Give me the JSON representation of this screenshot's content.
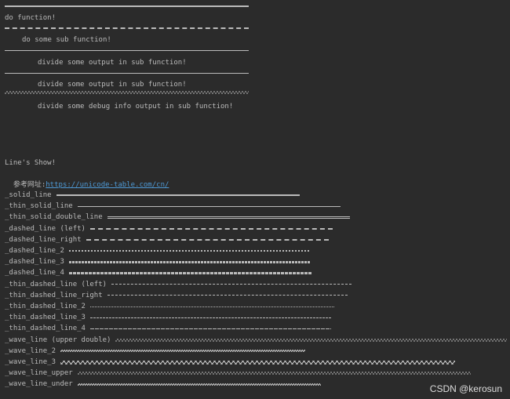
{
  "top": {
    "do_function": "do function!",
    "sub_function": "do some sub function!",
    "divide_output_1": "divide some output in sub function!",
    "divide_output_2": "divide some output in sub function!",
    "divide_debug": "divide some debug info output in sub function!"
  },
  "show": {
    "title": "Line's Show!",
    "ref_label": "参考网址:",
    "ref_url": "https://unicode-table.com/cn/"
  },
  "lines": [
    {
      "label": "_solid_line",
      "style": "solid"
    },
    {
      "label": "_thin_solid_line",
      "style": "thin"
    },
    {
      "label": "_thin_solid_double_line",
      "style": "double"
    },
    {
      "label": "_dashed_line (left)",
      "style": "dashed"
    },
    {
      "label": "_dashed_line_right",
      "style": "dashed"
    },
    {
      "label": "_dashed_line_2",
      "style": "dashed2"
    },
    {
      "label": "_dashed_line_3",
      "style": "dashed3"
    },
    {
      "label": "_dashed_line_4",
      "style": "dashed4"
    },
    {
      "label": "_thin_dashed_line (left)",
      "style": "tdashed"
    },
    {
      "label": "_thin_dashed_line_right",
      "style": "tdashed"
    },
    {
      "label": "_thin_dashed_line_2",
      "style": "tdashed2"
    },
    {
      "label": "_thin_dashed_line_3",
      "style": "tdashed3"
    },
    {
      "label": "_thin_dashed_line_4",
      "style": "tdashed4"
    },
    {
      "label": "_wave_line (upper double)",
      "style": "wave"
    },
    {
      "label": "_wave_line_2",
      "style": "wave2"
    },
    {
      "label": "_wave_line_3",
      "style": "wave3"
    },
    {
      "label": "_wave_line_upper",
      "style": "wave"
    },
    {
      "label": "_wave_line_under",
      "style": "wave2"
    }
  ],
  "watermark": "CSDN @kerosun",
  "colors": {
    "background": "#2b2b2b",
    "text": "#bbbbbb",
    "link": "#4e9ad6"
  }
}
